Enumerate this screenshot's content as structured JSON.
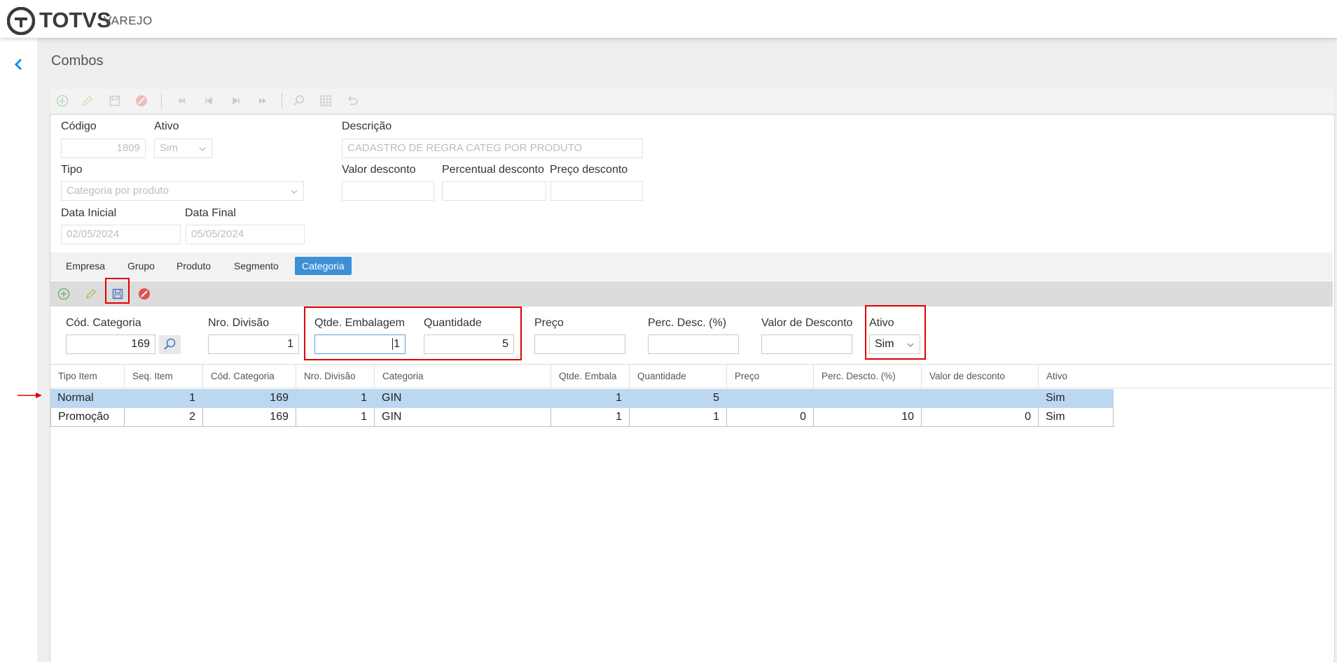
{
  "brand": {
    "name": "TOTVS",
    "sub": "VAREJO"
  },
  "page": {
    "title": "Combos"
  },
  "form": {
    "codigo_label": "Código",
    "codigo_value": "1809",
    "ativo_label": "Ativo",
    "ativo_value": "Sim",
    "descricao_label": "Descrição",
    "descricao_value": "CADASTRO DE REGRA CATEG POR PRODUTO",
    "tipo_label": "Tipo",
    "tipo_value": "Categoria por produto",
    "valor_desconto_label": "Valor desconto",
    "valor_desconto_value": "",
    "percentual_desconto_label": "Percentual desconto",
    "percentual_desconto_value": "",
    "preco_desconto_label": "Preço desconto",
    "preco_desconto_value": "",
    "data_inicial_label": "Data Inicial",
    "data_inicial_value": "02/05/2024",
    "data_final_label": "Data Final",
    "data_final_value": "05/05/2024"
  },
  "tabs": [
    {
      "label": "Empresa"
    },
    {
      "label": "Grupo"
    },
    {
      "label": "Produto"
    },
    {
      "label": "Segmento"
    },
    {
      "label": "Categoria"
    }
  ],
  "cat_form": {
    "cod_categoria_label": "Cód. Categoria",
    "cod_categoria_value": "169",
    "nro_divisao_label": "Nro. Divisão",
    "nro_divisao_value": "1",
    "qtde_embalagem_label": "Qtde. Embalagem",
    "qtde_embalagem_value": "1",
    "quantidade_label": "Quantidade",
    "quantidade_value": "5",
    "preco_label": "Preço",
    "preco_value": "",
    "perc_desc_label": "Perc. Desc. (%)",
    "perc_desc_value": "",
    "valor_desconto_label": "Valor de Desconto",
    "valor_desconto_value": "",
    "ativo_label": "Ativo",
    "ativo_value": "Sim"
  },
  "grid": {
    "headers": [
      "Tipo Item",
      "Seq. Item",
      "Cód. Categoria",
      "Nro. Divisão",
      "Categoria",
      "Qtde. Embala",
      "Quantidade",
      "Preço",
      "Perc. Descto. (%)",
      "Valor de desconto",
      "Ativo"
    ],
    "rows": [
      [
        "Normal",
        "1",
        "169",
        "1",
        "GIN",
        "1",
        "5",
        "",
        "",
        "",
        "Sim"
      ],
      [
        "Promoção",
        "2",
        "169",
        "1",
        "GIN",
        "1",
        "1",
        "0",
        "10",
        "0",
        "Sim"
      ]
    ]
  },
  "colors": {
    "accent": "#3d8fd6",
    "highlight": "#e00000",
    "selected_row": "#bcd7f0"
  }
}
